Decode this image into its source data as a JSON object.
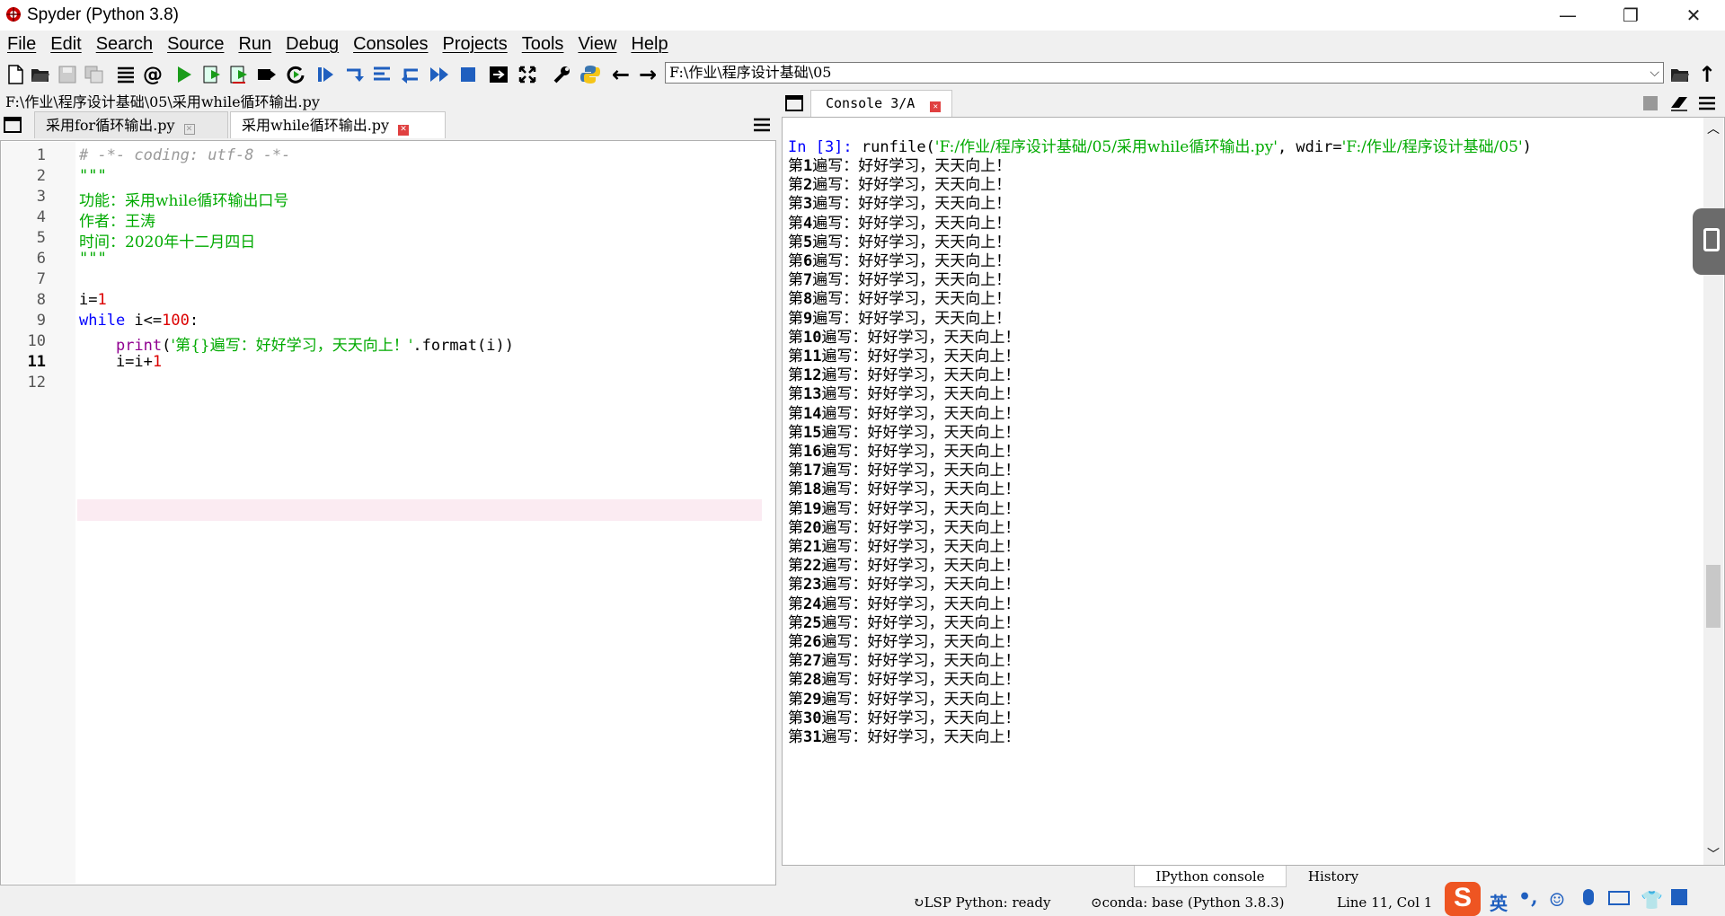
{
  "window": {
    "title": "Spyder (Python 3.8)",
    "controls": {
      "minimize": "—",
      "maximize": "❐",
      "close": "✕"
    }
  },
  "menu": [
    "File",
    "Edit",
    "Search",
    "Source",
    "Run",
    "Debug",
    "Consoles",
    "Projects",
    "Tools",
    "View",
    "Help"
  ],
  "toolbar": {
    "path_value": "F:\\作业\\程序设计基础\\05",
    "icons": [
      "new-file-icon",
      "open-file-icon",
      "save-icon",
      "save-all-icon",
      "list-icon",
      "at-icon",
      "run-icon",
      "run-cell-icon",
      "run-cell-advance-icon",
      "run-selection-icon",
      "rerun-icon",
      "debug-icon",
      "step-icon",
      "step-into-icon",
      "step-return-icon",
      "continue-icon",
      "stop-icon",
      "maximize-pane-icon",
      "fullscreen-icon",
      "preferences-icon",
      "python-path-icon",
      "back-icon",
      "forward-icon"
    ]
  },
  "editor": {
    "path": "F:\\作业\\程序设计基础\\05\\采用while循环输出.py",
    "tabs": [
      {
        "label": "采用for循环输出.py",
        "active": false
      },
      {
        "label": "采用while循环输出.py",
        "active": true
      }
    ],
    "current_line": 11,
    "lines": [
      {
        "n": "1",
        "text": "# -*- coding: utf-8 -*-"
      },
      {
        "n": "2",
        "text": "\"\"\""
      },
      {
        "n": "3",
        "text": "功能：采用while循环输出口号"
      },
      {
        "n": "4",
        "text": "作者：王涛"
      },
      {
        "n": "5",
        "text": "时间：2020年十二月四日"
      },
      {
        "n": "6",
        "text": "\"\"\""
      },
      {
        "n": "7",
        "text": ""
      },
      {
        "n": "8",
        "text": "i=1"
      },
      {
        "n": "9",
        "text": "while i<=100:"
      },
      {
        "n": "10",
        "text": "    print('第{}遍写：好好学习，天天向上！'.format(i))"
      },
      {
        "n": "11",
        "text": "    i=i+1"
      },
      {
        "n": "12",
        "text": ""
      }
    ]
  },
  "console": {
    "tab_label": "Console 3/A",
    "prompt": "In [3]:",
    "command": "runfile(",
    "file_arg": "'F:/作业/程序设计基础/05/采用while循环输出.py'",
    "wdir_label": ", wdir=",
    "wdir_arg": "'F:/作业/程序设计基础/05'",
    "close_paren": ")",
    "line_prefix": "第",
    "line_suffix": "遍写：好好学习，天天向上！",
    "output_count": [
      1,
      2,
      3,
      4,
      5,
      6,
      7,
      8,
      9,
      10,
      11,
      12,
      13,
      14,
      15,
      16,
      17,
      18,
      19,
      20,
      21,
      22,
      23,
      24,
      25,
      26,
      27,
      28,
      29,
      30,
      31
    ]
  },
  "bottom_tabs": [
    "IPython console",
    "History"
  ],
  "status": {
    "lsp": "LSP Python: ready",
    "conda": "conda: base (Python 3.8.3)",
    "position": "Line 11, Col 1"
  },
  "colors": {
    "keyword": "#0000ff",
    "string": "#00aa00",
    "comment": "#999999",
    "number": "#dc0000",
    "builtin": "#900090",
    "prompt": "#0000ff",
    "current_line": "#fbebf2"
  }
}
